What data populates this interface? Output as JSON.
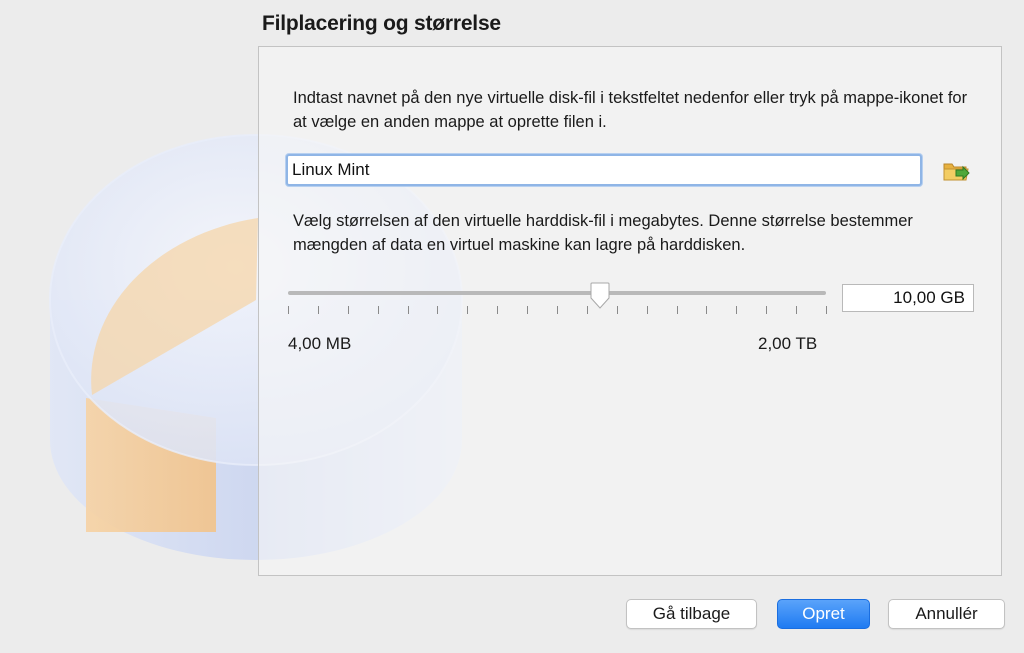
{
  "wizard": {
    "title": "Filplacering og størrelse"
  },
  "location": {
    "description": "Indtast navnet på den nye virtuelle disk-fil i tekstfeltet nedenfor eller tryk på mappe-ikonet for at vælge en anden mappe at oprette filen i.",
    "file_name": "Linux Mint",
    "folder_icon": "folder-icon"
  },
  "size": {
    "description": "Vælg størrelsen af den virtuelle harddisk-fil i megabytes. Denne størrelse bestemmer mængden af data en virtuel maskine kan lagre på harddisken.",
    "value_text": "10,00 GB",
    "min_label": "4,00 MB",
    "max_label": "2,00 TB",
    "slider_fraction": 0.58
  },
  "buttons": {
    "back": "Gå tilbage",
    "create": "Opret",
    "cancel": "Annullér"
  },
  "colors": {
    "accent": "#2a84f6",
    "disk_body": "#c7d3f2",
    "disk_slice": "#f6ce96"
  }
}
